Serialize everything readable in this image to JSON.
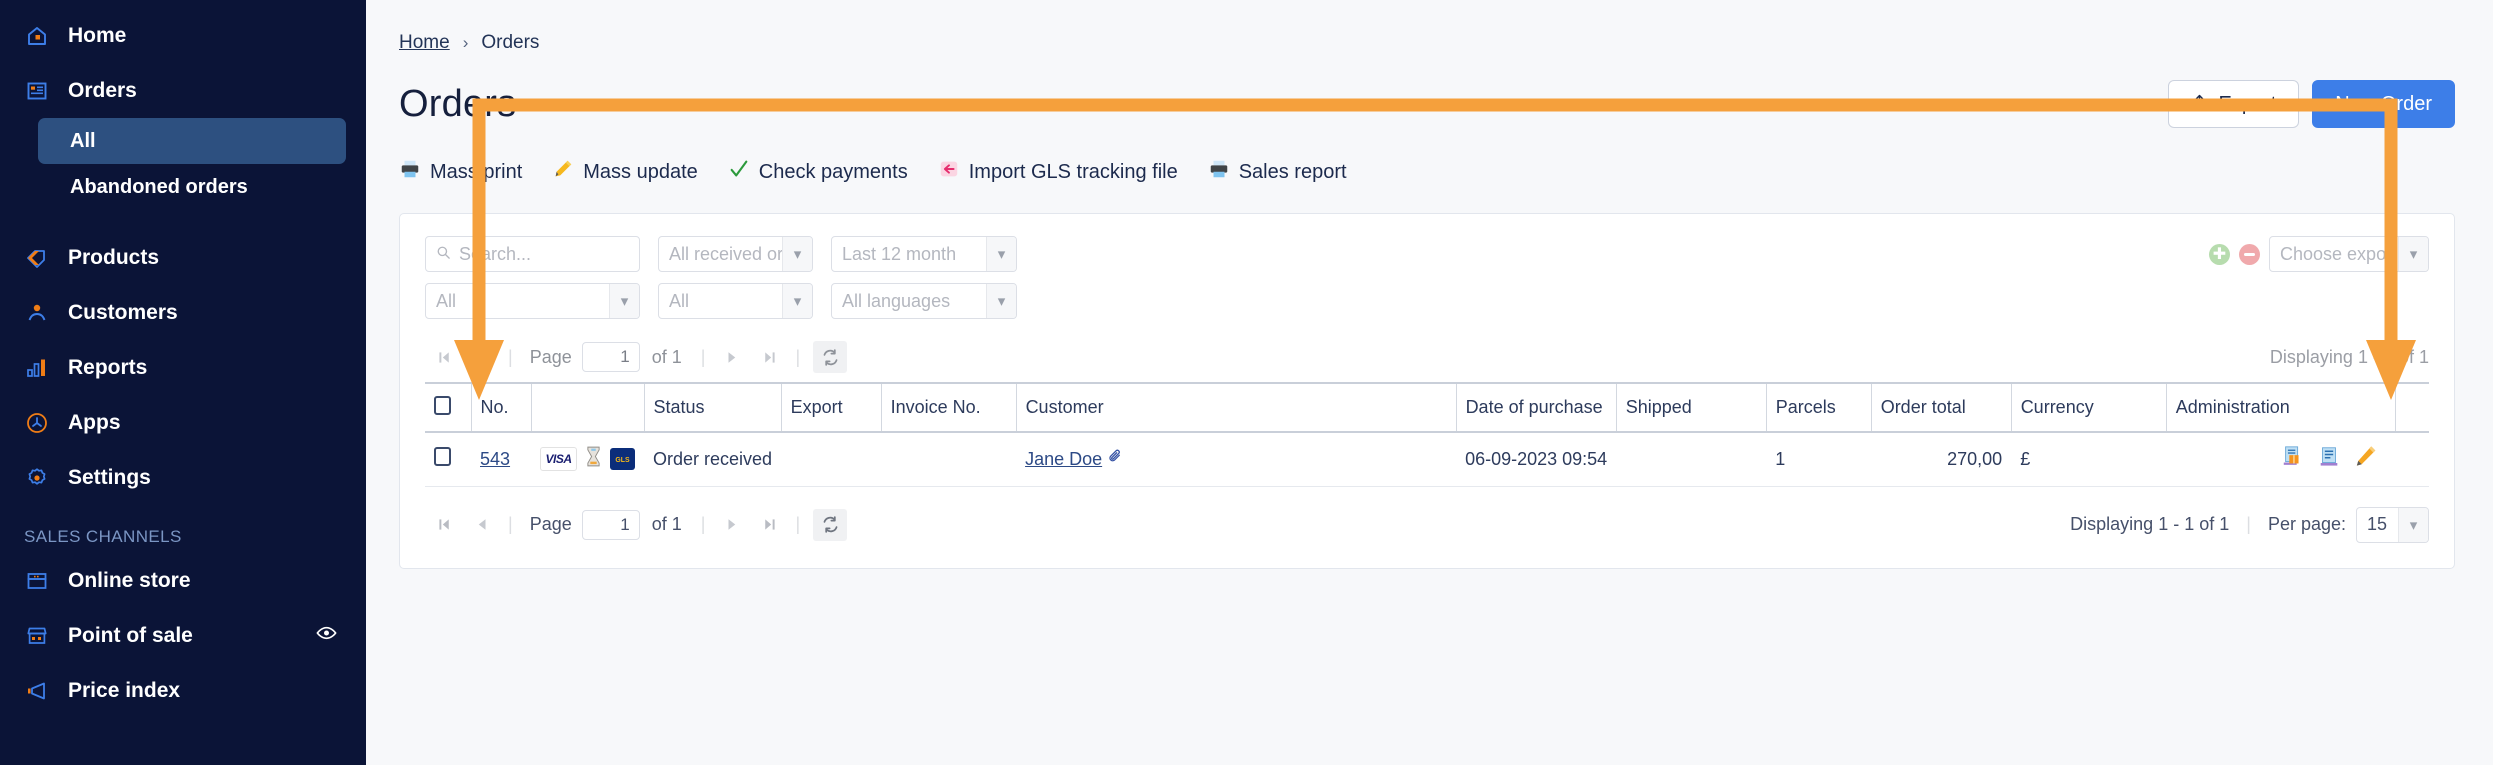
{
  "sidebar": {
    "items": [
      {
        "label": "Home",
        "icon": "home-icon"
      },
      {
        "label": "Orders",
        "icon": "orders-icon"
      }
    ],
    "order_subitems": [
      {
        "label": "All",
        "active": true
      },
      {
        "label": "Abandoned orders",
        "active": false
      }
    ],
    "items2": [
      {
        "label": "Products",
        "icon": "tag-icon"
      },
      {
        "label": "Customers",
        "icon": "user-icon"
      },
      {
        "label": "Reports",
        "icon": "bar-chart-icon"
      },
      {
        "label": "Apps",
        "icon": "apps-icon"
      },
      {
        "label": "Settings",
        "icon": "gear-icon"
      }
    ],
    "section_label": "SALES CHANNELS",
    "channels": [
      {
        "label": "Online store",
        "icon": "store-icon",
        "eye": false
      },
      {
        "label": "Point of sale",
        "icon": "pos-icon",
        "eye": true
      },
      {
        "label": "Price index",
        "icon": "megaphone-icon",
        "eye": false
      }
    ]
  },
  "breadcrumb": {
    "home": "Home",
    "separator": "›",
    "current": "Orders"
  },
  "page_title": "Orders",
  "header_buttons": {
    "export": "Export",
    "new_order": "New Order"
  },
  "actions": [
    {
      "label": "Mass print",
      "icon": "printer-icon"
    },
    {
      "label": "Mass update",
      "icon": "pencil-icon"
    },
    {
      "label": "Check payments",
      "icon": "checkmark-icon"
    },
    {
      "label": "Import GLS tracking file",
      "icon": "import-arrow-icon"
    },
    {
      "label": "Sales report",
      "icon": "printer-icon"
    }
  ],
  "filters": {
    "search_placeholder": "Search...",
    "status_filter": "All received or",
    "period_filter": "Last 12 month",
    "filter_all_1": "All",
    "filter_all_2": "All",
    "language_filter": "All languages",
    "choose_export": "Choose export",
    "add_symbol": "✚",
    "remove_symbol": "➖"
  },
  "pagination_top": {
    "first": "⏮",
    "prev": "◀",
    "page_label": "Page",
    "page_value": "1",
    "of_label": "of 1",
    "next": "▶",
    "last": "⏭",
    "refresh": "↻",
    "displaying": "Displaying 1 - 1 of 1"
  },
  "pagination_bottom": {
    "page_label": "Page",
    "page_value": "1",
    "of_label": "of 1",
    "displaying": "Displaying 1 - 1 of 1",
    "per_page_label": "Per page:",
    "per_page_value": "15"
  },
  "table": {
    "columns": [
      "",
      "No.",
      "",
      "Status",
      "Export",
      "Invoice No.",
      "Customer",
      "Date of purchase",
      "Shipped",
      "Parcels",
      "Order total",
      "Currency",
      "Administration",
      ""
    ],
    "rows": [
      {
        "order_no": "543",
        "payment_icon": "visa-icon",
        "hourglass_icon": "hourglass-icon",
        "carrier_icon": "gls-icon",
        "carrier_label": "GLS",
        "status": "Order received",
        "export": "",
        "invoice_no": "",
        "customer": "Jane Doe",
        "customer_attachment_icon": "paperclip-icon",
        "date_of_purchase": "06-09-2023 09:54",
        "shipped": "",
        "parcels": "1",
        "order_total": "270,00",
        "currency": "£",
        "admin_icons": [
          "invoice-icon",
          "delivery-note-icon",
          "edit-pencil-icon"
        ]
      }
    ]
  },
  "annotation": {
    "color": "#f5a03c",
    "shape": "bracket-with-two-down-arrows"
  },
  "colors": {
    "sidebar_bg": "#0b1437",
    "sidebar_active": "#2d5080",
    "accent_blue": "#3d7ee8",
    "accent_orange": "#f07d16",
    "page_bg": "#f7f8fa"
  }
}
